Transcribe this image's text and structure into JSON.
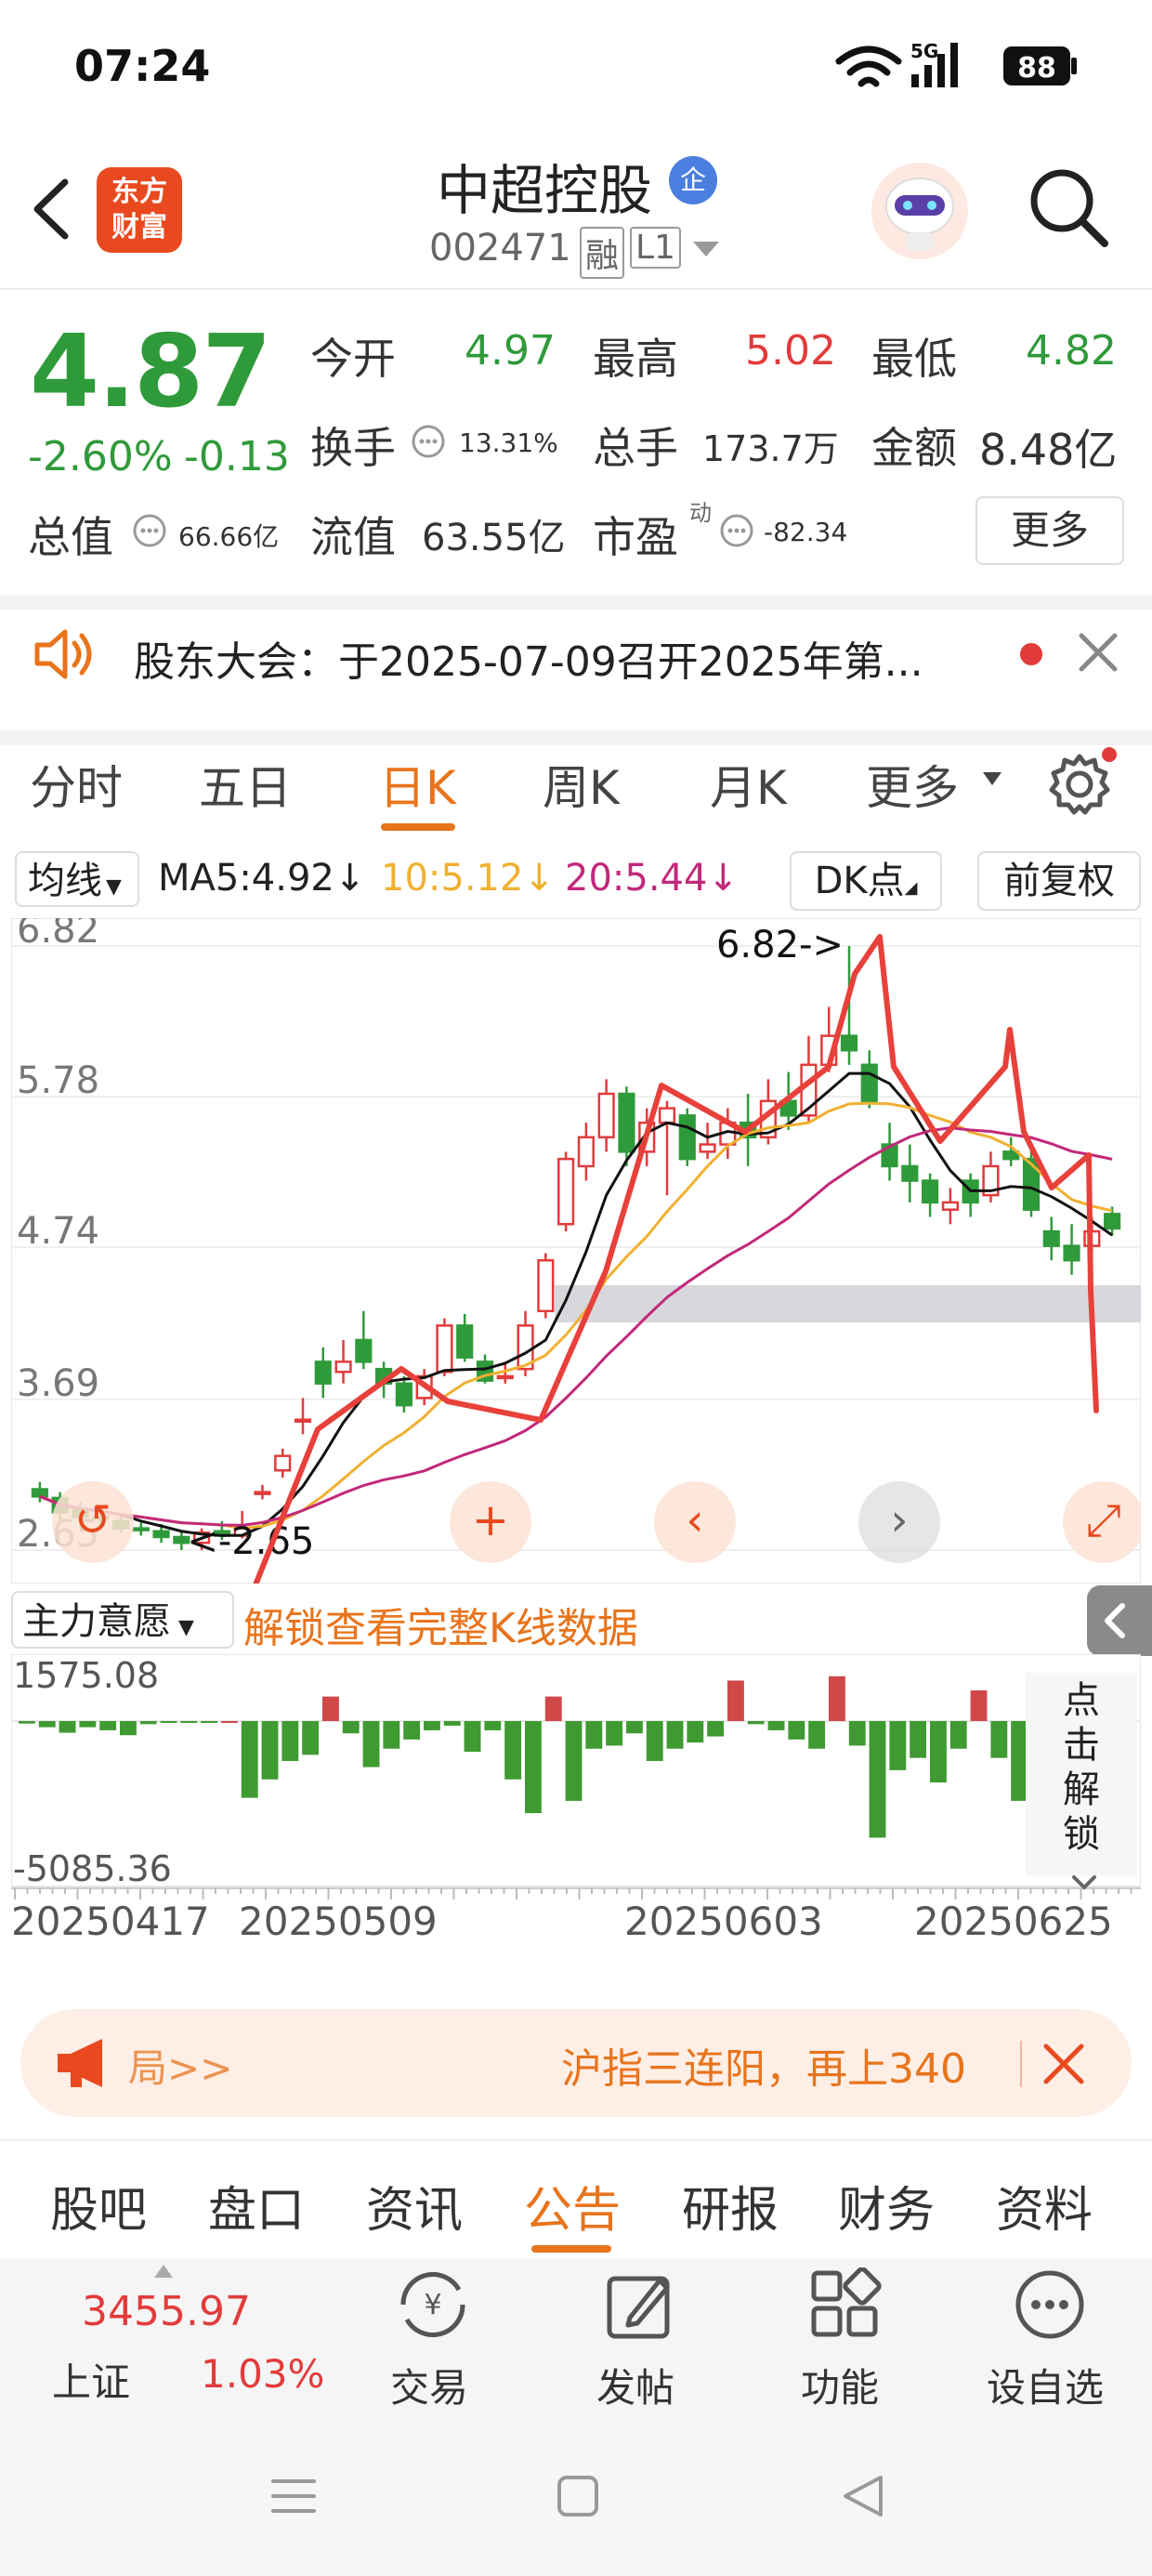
{
  "status": {
    "time": "07:24",
    "network": "5G",
    "battery": "88"
  },
  "header": {
    "logo": "东方\n财富",
    "stock_name": "中超控股",
    "badge": "企",
    "code": "002471",
    "tag1": "融",
    "tag2": "L1"
  },
  "quote": {
    "price": "4.87",
    "change_pct": "-2.60%",
    "change": "-0.13",
    "open_label": "今开",
    "open": "4.97",
    "high_label": "最高",
    "high": "5.02",
    "low_label": "最低",
    "low": "4.82",
    "turnover_label": "换手",
    "turnover": "13.31%",
    "volume_label": "总手",
    "volume": "173.7万",
    "amount_label": "金额",
    "amount": "8.48亿",
    "mktcap_label": "总值",
    "mktcap": "66.66亿",
    "float_label": "流值",
    "float": "63.55亿",
    "pe_label": "市盈",
    "pe_sup": "动",
    "pe": "-82.34",
    "more": "更多"
  },
  "notice": {
    "text": "股东大会：于2025-07-09召开2025年第..."
  },
  "tabs": {
    "items": [
      "分时",
      "五日",
      "日K",
      "周K",
      "月K",
      "更多"
    ],
    "active": "日K"
  },
  "ma": {
    "selector": "均线",
    "ma5": "MA5:4.92",
    "ma10": "10:5.12",
    "ma20": "20:5.44",
    "dk": "DK点",
    "adjust": "前复权"
  },
  "chart_data": {
    "type": "candlestick",
    "y_ticks": [
      "6.82",
      "5.78",
      "4.74",
      "3.69",
      "2.65"
    ],
    "ylim": [
      2.65,
      6.82
    ],
    "high_marker": "6.82->",
    "low_marker": "<-2.65",
    "x_ticks": [
      "20250417",
      "20250509",
      "20250603",
      "20250625"
    ],
    "candles": [
      {
        "o": 3.07,
        "c": 3.02,
        "h": 3.12,
        "l": 2.98
      },
      {
        "o": 3.01,
        "c": 2.91,
        "h": 3.05,
        "l": 2.85
      },
      {
        "o": 2.93,
        "c": 2.88,
        "h": 2.98,
        "l": 2.84
      },
      {
        "o": 2.88,
        "c": 2.87,
        "h": 2.92,
        "l": 2.82
      },
      {
        "o": 2.85,
        "c": 2.8,
        "h": 2.9,
        "l": 2.77
      },
      {
        "o": 2.8,
        "c": 2.79,
        "h": 2.84,
        "l": 2.75
      },
      {
        "o": 2.78,
        "c": 2.74,
        "h": 2.83,
        "l": 2.7
      },
      {
        "o": 2.74,
        "c": 2.7,
        "h": 2.78,
        "l": 2.65
      },
      {
        "o": 2.7,
        "c": 2.77,
        "h": 2.8,
        "l": 2.65
      },
      {
        "o": 2.78,
        "c": 2.75,
        "h": 2.85,
        "l": 2.72
      },
      {
        "o": 2.75,
        "c": 2.8,
        "h": 2.92,
        "l": 2.73
      },
      {
        "o": 3.05,
        "c": 3.05,
        "h": 3.1,
        "l": 3.0
      },
      {
        "o": 3.2,
        "c": 3.3,
        "h": 3.35,
        "l": 3.15
      },
      {
        "o": 3.55,
        "c": 3.55,
        "h": 3.7,
        "l": 3.45
      },
      {
        "o": 3.95,
        "c": 3.8,
        "h": 4.05,
        "l": 3.7
      },
      {
        "o": 3.88,
        "c": 3.95,
        "h": 4.1,
        "l": 3.8
      },
      {
        "o": 4.1,
        "c": 3.95,
        "h": 4.3,
        "l": 3.9
      },
      {
        "o": 3.9,
        "c": 3.8,
        "h": 3.95,
        "l": 3.7
      },
      {
        "o": 3.8,
        "c": 3.65,
        "h": 3.85,
        "l": 3.6
      },
      {
        "o": 3.7,
        "c": 3.85,
        "h": 3.9,
        "l": 3.65
      },
      {
        "o": 3.88,
        "c": 4.2,
        "h": 4.25,
        "l": 3.85
      },
      {
        "o": 4.2,
        "c": 3.98,
        "h": 4.28,
        "l": 3.95
      },
      {
        "o": 3.95,
        "c": 3.82,
        "h": 4.0,
        "l": 3.8
      },
      {
        "o": 3.85,
        "c": 3.85,
        "h": 3.95,
        "l": 3.8
      },
      {
        "o": 3.9,
        "c": 4.2,
        "h": 4.3,
        "l": 3.85
      },
      {
        "o": 4.3,
        "c": 4.65,
        "h": 4.7,
        "l": 4.25
      },
      {
        "o": 4.9,
        "c": 5.35,
        "h": 5.4,
        "l": 4.85
      },
      {
        "o": 5.3,
        "c": 5.5,
        "h": 5.6,
        "l": 5.2
      },
      {
        "o": 5.5,
        "c": 5.8,
        "h": 5.9,
        "l": 5.4
      },
      {
        "o": 5.8,
        "c": 5.4,
        "h": 5.85,
        "l": 5.3
      },
      {
        "o": 5.4,
        "c": 5.6,
        "h": 5.7,
        "l": 5.3
      },
      {
        "o": 5.6,
        "c": 5.7,
        "h": 5.75,
        "l": 5.1
      },
      {
        "o": 5.65,
        "c": 5.35,
        "h": 5.7,
        "l": 5.3
      },
      {
        "o": 5.4,
        "c": 5.45,
        "h": 5.6,
        "l": 5.35
      },
      {
        "o": 5.45,
        "c": 5.6,
        "h": 5.7,
        "l": 5.35
      },
      {
        "o": 5.6,
        "c": 5.5,
        "h": 5.8,
        "l": 5.3
      },
      {
        "o": 5.5,
        "c": 5.75,
        "h": 5.9,
        "l": 5.45
      },
      {
        "o": 5.75,
        "c": 5.65,
        "h": 5.95,
        "l": 5.55
      },
      {
        "o": 5.65,
        "c": 6.0,
        "h": 6.2,
        "l": 5.6
      },
      {
        "o": 6.0,
        "c": 6.2,
        "h": 6.4,
        "l": 5.95
      },
      {
        "o": 6.2,
        "c": 6.1,
        "h": 6.82,
        "l": 6.0
      },
      {
        "o": 6.0,
        "c": 5.75,
        "h": 6.1,
        "l": 5.7
      },
      {
        "o": 5.45,
        "c": 5.3,
        "h": 5.6,
        "l": 5.2
      },
      {
        "o": 5.3,
        "c": 5.2,
        "h": 5.45,
        "l": 5.05
      },
      {
        "o": 5.2,
        "c": 5.05,
        "h": 5.25,
        "l": 4.95
      },
      {
        "o": 5.0,
        "c": 5.05,
        "h": 5.15,
        "l": 4.9
      },
      {
        "o": 5.2,
        "c": 5.05,
        "h": 5.25,
        "l": 4.95
      },
      {
        "o": 5.1,
        "c": 5.3,
        "h": 5.4,
        "l": 5.05
      },
      {
        "o": 5.4,
        "c": 5.35,
        "h": 5.5,
        "l": 5.3
      },
      {
        "o": 5.35,
        "c": 5.0,
        "h": 5.45,
        "l": 4.95
      },
      {
        "o": 4.85,
        "c": 4.75,
        "h": 4.95,
        "l": 4.65
      },
      {
        "o": 4.75,
        "c": 4.65,
        "h": 4.9,
        "l": 4.55
      },
      {
        "o": 4.75,
        "c": 4.85,
        "h": 4.95,
        "l": 4.7
      },
      {
        "o": 4.97,
        "c": 4.87,
        "h": 5.02,
        "l": 4.82
      }
    ],
    "ma_colors": {
      "ma5": "#111111",
      "ma10": "#f0b030",
      "ma20": "#c2287a"
    }
  },
  "indicator": {
    "selector": "主力意愿",
    "unlock_text": "解锁查看完整K线数据",
    "top": "1575.08",
    "bottom": "-5085.36",
    "side_text": "点击解锁",
    "bars": [
      -80,
      -200,
      -380,
      -200,
      -300,
      -460,
      -100,
      -60,
      -40,
      -60,
      0,
      -2500,
      -1900,
      -1300,
      -1100,
      800,
      -400,
      -1500,
      -900,
      -600,
      -300,
      -150,
      -1000,
      -300,
      -1900,
      -3000,
      800,
      -2600,
      -900,
      -800,
      -400,
      -1300,
      -900,
      -700,
      -500,
      1320,
      -100,
      -300,
      -600,
      -900,
      1460,
      -800,
      -3800,
      -1600,
      -1200,
      -2000,
      -900,
      1000,
      -1200,
      -2600
    ]
  },
  "banner": {
    "left": "局>>",
    "text": "沪指三连阳，再上340"
  },
  "bottom_tabs": {
    "items": [
      "股吧",
      "盘口",
      "资讯",
      "公告",
      "研报",
      "财务",
      "资料"
    ],
    "active": "公告"
  },
  "toolbar": {
    "index_value": "3455.97",
    "index_name": "上证",
    "index_change": "1.03%",
    "trade": "交易",
    "post": "发帖",
    "function": "功能",
    "watchlist": "设自选"
  },
  "colors": {
    "up": "#e23b3b",
    "down": "#2f9a3a",
    "accent": "#e8741c"
  }
}
